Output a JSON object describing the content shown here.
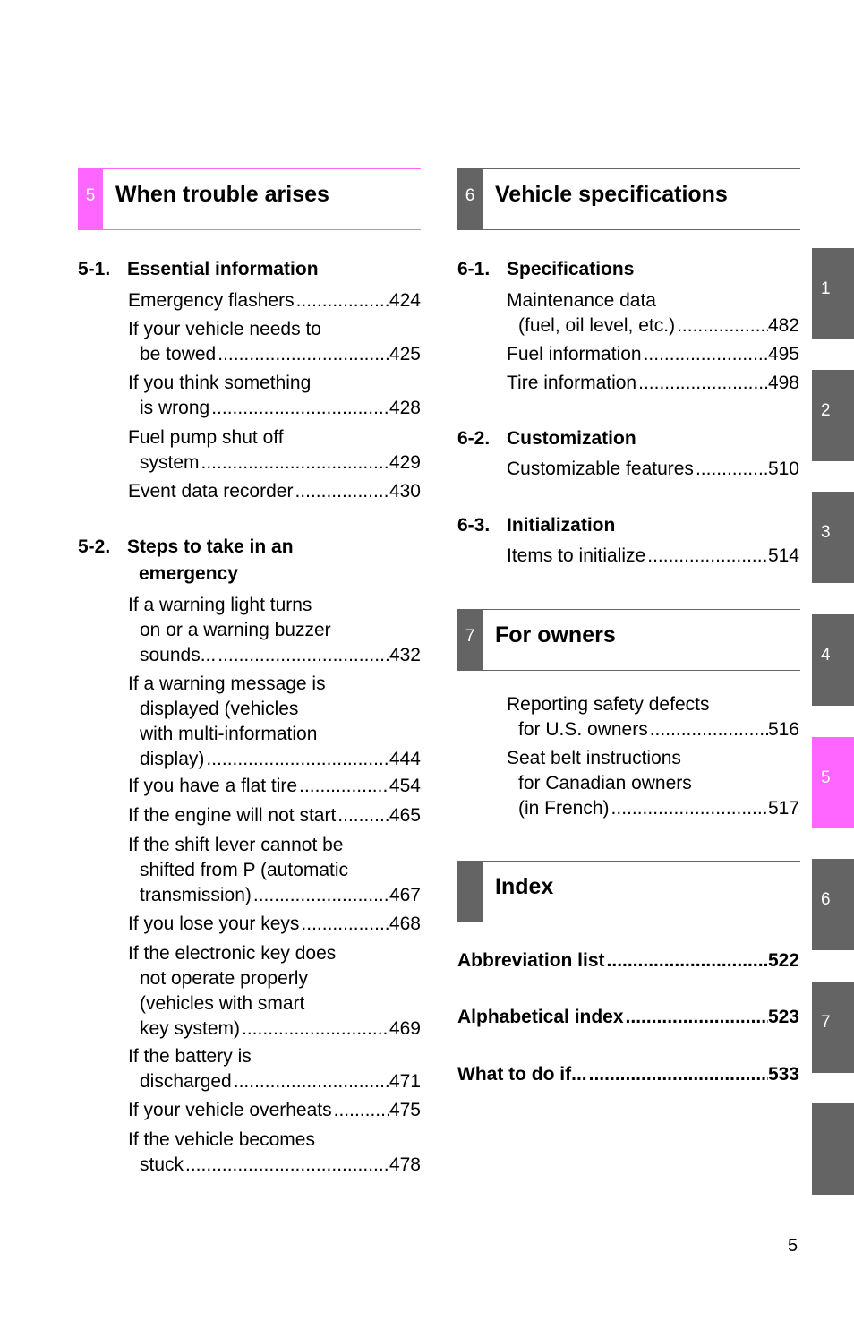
{
  "colors": {
    "active_accent": "#ff66ff",
    "tab_gray": "#646464"
  },
  "left": {
    "chapter": {
      "number": "5",
      "title": "When trouble arises"
    },
    "sections": [
      {
        "number": "5-1.",
        "title": "Essential information"
      },
      {
        "number": "5-2.",
        "title_line1": "Steps to take in an",
        "title_line2": "emergency"
      }
    ],
    "entries_5_1": [
      {
        "lines": [],
        "last": "Emergency flashers",
        "page": "424"
      },
      {
        "lines": [
          "If your vehicle needs to"
        ],
        "last": "be towed",
        "page": "425"
      },
      {
        "lines": [
          "If you think something"
        ],
        "last": "is wrong",
        "page": "428"
      },
      {
        "lines": [
          "Fuel pump shut off"
        ],
        "last": "system",
        "page": "429"
      },
      {
        "lines": [],
        "last": "Event data recorder",
        "page": "430"
      }
    ],
    "entries_5_2": [
      {
        "lines": [
          "If a warning light turns",
          "on or a warning buzzer"
        ],
        "last": "sounds...",
        "page": "432"
      },
      {
        "lines": [
          "If a warning message is",
          "displayed (vehicles",
          "with multi-information"
        ],
        "last": "display)",
        "page": "444"
      },
      {
        "lines": [],
        "last": "If you have a flat tire",
        "page": "454"
      },
      {
        "lines": [],
        "last": "If the engine will not start",
        "page": "465"
      },
      {
        "lines": [
          "If the shift lever cannot be",
          "shifted from P (automatic"
        ],
        "last": "transmission)",
        "page": "467"
      },
      {
        "lines": [],
        "last": "If you lose your keys",
        "page": "468"
      },
      {
        "lines": [
          "If the electronic key does",
          "not operate properly",
          "(vehicles with smart"
        ],
        "last": "key system)",
        "page": "469"
      },
      {
        "lines": [
          "If the battery is"
        ],
        "last": "discharged",
        "page": "471"
      },
      {
        "lines": [],
        "last": "If your vehicle overheats",
        "page": "475"
      },
      {
        "lines": [
          "If the vehicle becomes"
        ],
        "last": "stuck",
        "page": "478"
      }
    ]
  },
  "right": {
    "chapter6": {
      "number": "6",
      "title": "Vehicle specifications"
    },
    "sections6": [
      {
        "number": "6-1.",
        "title": "Specifications"
      },
      {
        "number": "6-2.",
        "title": "Customization"
      },
      {
        "number": "6-3.",
        "title": "Initialization"
      }
    ],
    "entries_6_1": [
      {
        "lines": [
          "Maintenance data"
        ],
        "last": "(fuel, oil level, etc.)",
        "page": "482"
      },
      {
        "lines": [],
        "last": "Fuel information",
        "page": "495"
      },
      {
        "lines": [],
        "last": "Tire information",
        "page": "498"
      }
    ],
    "entries_6_2": [
      {
        "lines": [],
        "last": "Customizable features",
        "page": "510"
      }
    ],
    "entries_6_3": [
      {
        "lines": [],
        "last": "Items to initialize",
        "page": "514"
      }
    ],
    "chapter7": {
      "number": "7",
      "title": "For owners"
    },
    "entries_7": [
      {
        "lines": [
          "Reporting safety defects"
        ],
        "last": "for U.S. owners",
        "page": "516"
      },
      {
        "lines": [
          "Seat belt instructions",
          "for Canadian owners"
        ],
        "last": "(in French)",
        "page": "517"
      }
    ],
    "index": {
      "number": "",
      "title": "Index"
    },
    "index_entries": [
      {
        "lines": [],
        "last": "Abbreviation list",
        "page": "522"
      },
      {
        "lines": [],
        "last": "Alphabetical index",
        "page": "523"
      },
      {
        "lines": [],
        "last": "What to do if...",
        "page": "533"
      }
    ]
  },
  "side_tabs": [
    {
      "label": "1",
      "active": false
    },
    {
      "label": "2",
      "active": false
    },
    {
      "label": "3",
      "active": false
    },
    {
      "label": "4",
      "active": false
    },
    {
      "label": "5",
      "active": true
    },
    {
      "label": "6",
      "active": false
    },
    {
      "label": "7",
      "active": false
    },
    {
      "label": "",
      "active": false
    }
  ],
  "page_number": "5"
}
